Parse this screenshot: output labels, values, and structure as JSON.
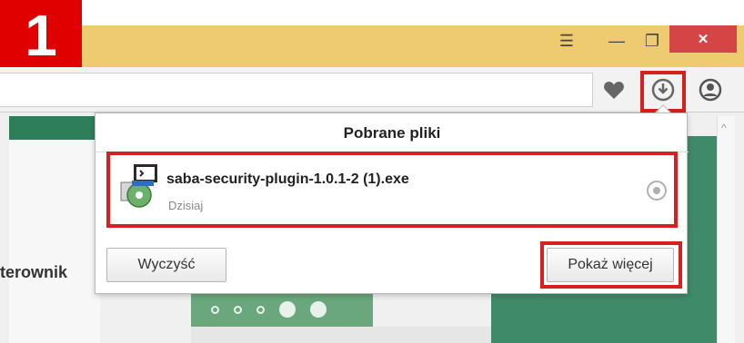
{
  "step_badge": "1",
  "window_controls": {
    "menu": "☰",
    "minimize": "—",
    "maximize": "❐",
    "close": "✕"
  },
  "page": {
    "partial_text": "terownik"
  },
  "downloads_panel": {
    "title": "Pobrane pliki",
    "item": {
      "filename": "saba-security-plugin-1.0.1-2 (1).exe",
      "date": "Dzisiaj"
    },
    "clear_button": "Wyczyść",
    "show_more_button": "Pokaż więcej"
  },
  "colors": {
    "accent_highlight": "#d61f1f",
    "titlebar": "#eecb70",
    "page_green": "#3f8a68"
  },
  "icons": {
    "heart": "heart-icon",
    "download": "download-icon",
    "account": "account-icon",
    "file": "installer-file-icon",
    "folder": "show-in-folder-icon"
  }
}
